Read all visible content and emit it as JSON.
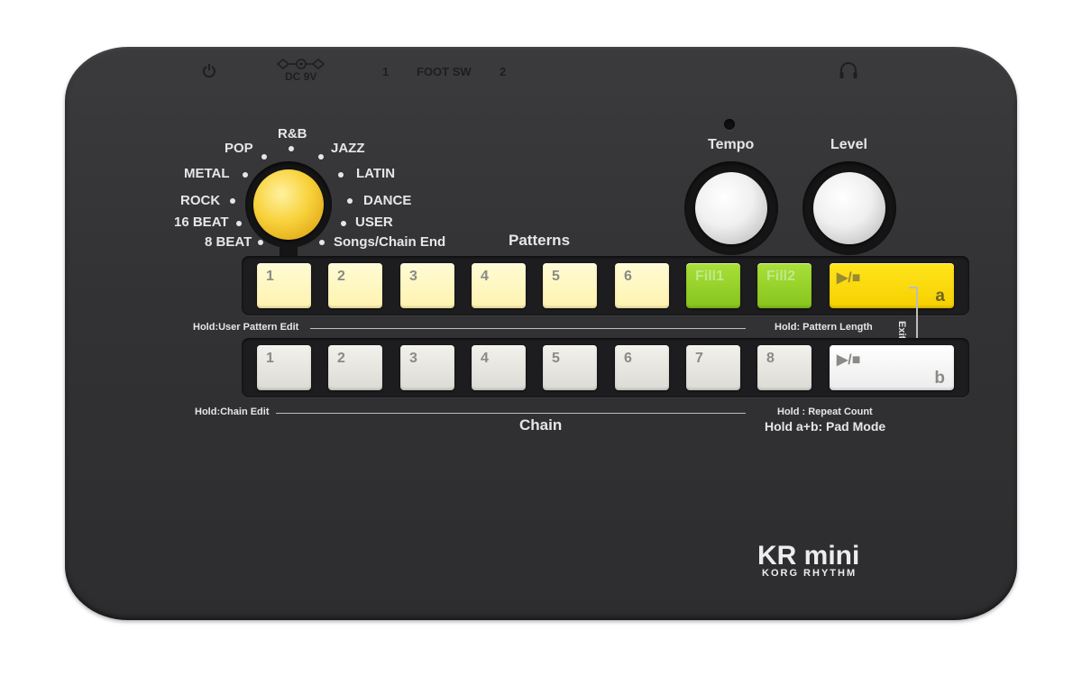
{
  "top_markings": {
    "dc": "DC 9V",
    "foot_sw_1": "1",
    "foot_sw": "FOOT SW",
    "foot_sw_2": "2"
  },
  "genres": {
    "rb": "R&B",
    "pop": "POP",
    "jazz": "JAZZ",
    "metal": "METAL",
    "latin": "LATIN",
    "rock": "ROCK",
    "dance": "DANCE",
    "beat16": "16 BEAT",
    "user": "USER",
    "beat8": "8 BEAT",
    "songs": "Songs/Chain End"
  },
  "knobs": {
    "tempo": "Tempo",
    "level": "Level"
  },
  "patterns": {
    "title": "Patterns",
    "pads": [
      "1",
      "2",
      "3",
      "4",
      "5",
      "6"
    ],
    "fills": [
      "Fill1",
      "Fill2"
    ],
    "play": "▶/■",
    "play_letter": "a",
    "hold_left": "Hold:User Pattern Edit",
    "hold_right": "Hold: Pattern Length"
  },
  "chain": {
    "title": "Chain",
    "pads": [
      "1",
      "2",
      "3",
      "4",
      "5",
      "6",
      "7",
      "8"
    ],
    "play": "▶/■",
    "play_letter": "b",
    "hold_left": "Hold:Chain Edit",
    "hold_right": "Hold : Repeat Count",
    "hold_ab": "Hold a+b: Pad Mode"
  },
  "exit_label": "Exit",
  "logo": {
    "main": "KR mini",
    "sub": "KORG RHYTHM"
  },
  "colors": {
    "body": "#333335",
    "pattern_pad": "#fff6c0",
    "fill_pad": "#96d12a",
    "play_a": "#ffdc00",
    "chain_pad": "#e8e7e2",
    "selector_knob": "#f3c830"
  }
}
